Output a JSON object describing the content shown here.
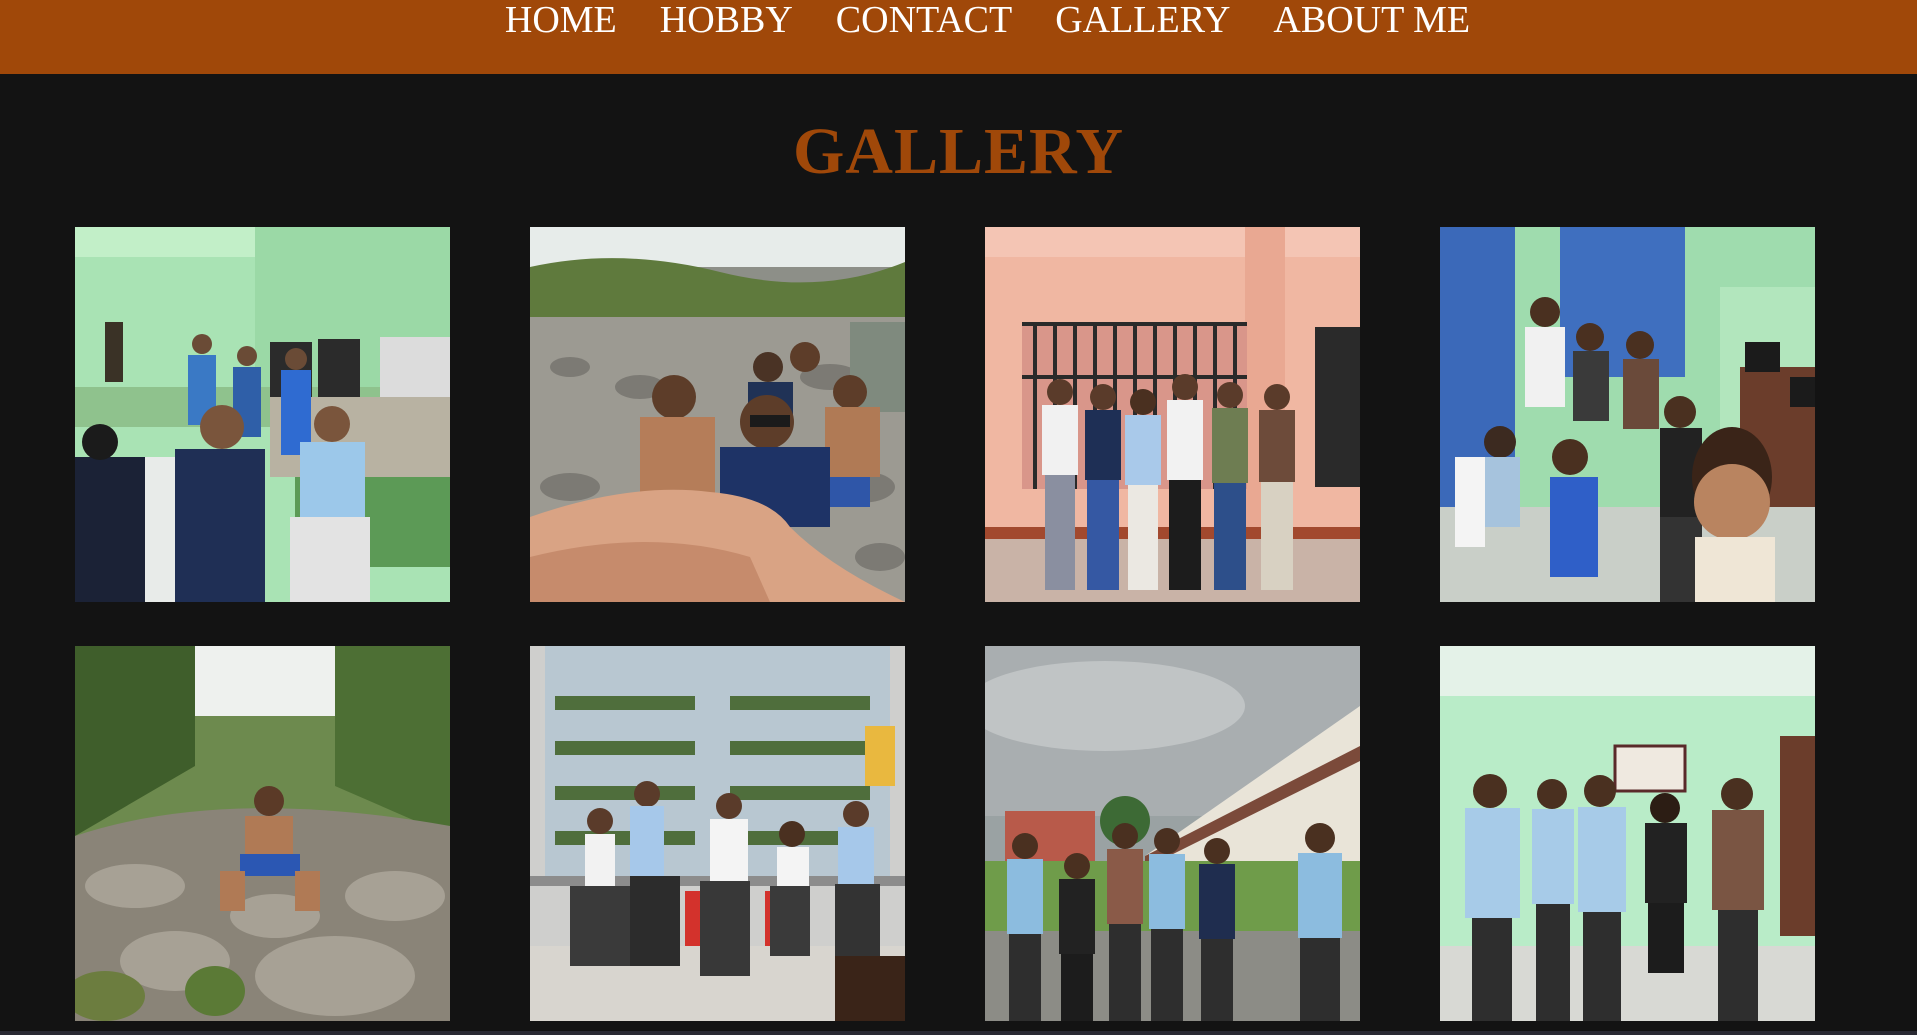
{
  "nav": {
    "items": [
      {
        "label": "HOME"
      },
      {
        "label": "HOBBY"
      },
      {
        "label": "CONTACT"
      },
      {
        "label": "GALLERY"
      },
      {
        "label": "ABOUT ME"
      }
    ]
  },
  "page": {
    "title": "GALLERY"
  },
  "gallery": {
    "photos": [
      {
        "scene": "computer-lab-group"
      },
      {
        "scene": "river-selfie"
      },
      {
        "scene": "building-front-group"
      },
      {
        "scene": "classroom-selfie"
      },
      {
        "scene": "river-rocks-sitting"
      },
      {
        "scene": "store-front-chairs"
      },
      {
        "scene": "campus-outdoor-group"
      },
      {
        "scene": "classroom-group"
      }
    ]
  },
  "colors": {
    "navbar": "#a04809",
    "title": "#a04809",
    "background": "#131313",
    "nav_text": "#ffffff"
  }
}
